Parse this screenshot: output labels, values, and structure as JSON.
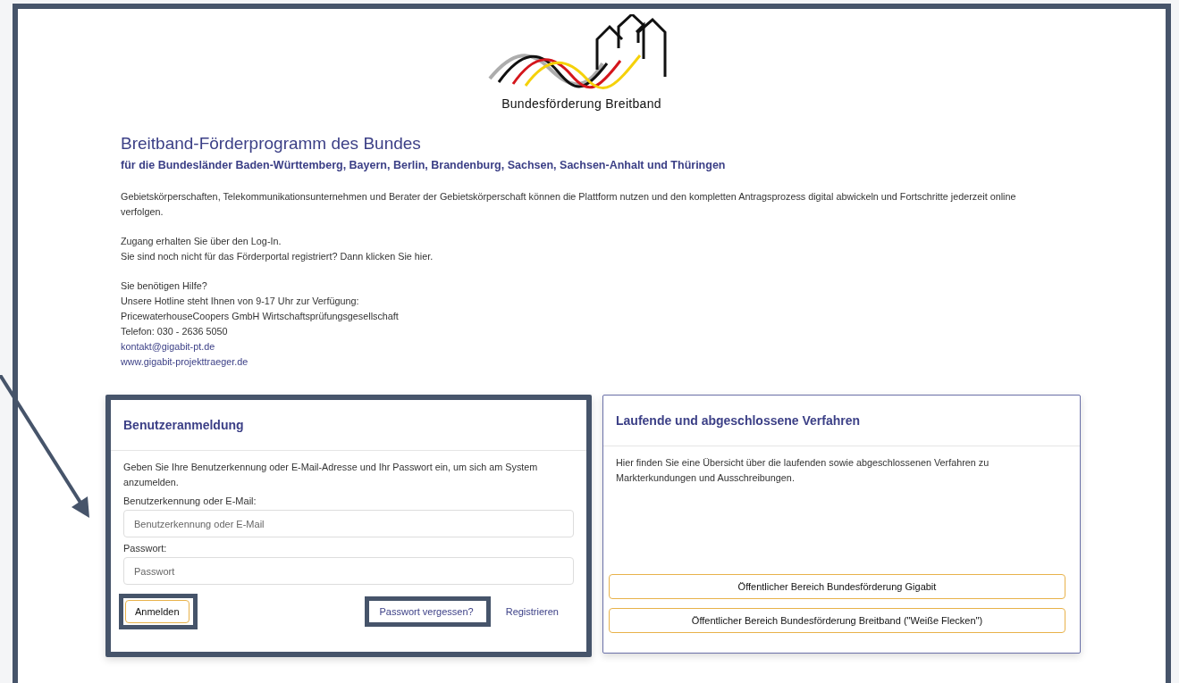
{
  "logo": {
    "text": "Bundesförderung Breitband"
  },
  "heading": {
    "title": "Breitband-Förderprogramm des Bundes",
    "subtitle": "für die Bundesländer Baden-Württemberg, Bayern, Berlin, Brandenburg, Sachsen, Sachsen-Anhalt und Thüringen"
  },
  "paragraphs": [
    {
      "lines": [
        {
          "kind": "text",
          "text": "Gebietskörperschaften, Telekommunikationsunternehmen und Berater der Gebietskörperschaft können die Plattform nutzen und den kompletten Antragsprozess digital abwickeln und Fortschritte jederzeit online verfolgen."
        }
      ]
    },
    {
      "lines": [
        {
          "kind": "text",
          "text": "Zugang erhalten Sie über den Log-In."
        },
        {
          "kind": "text",
          "text": "Sie sind noch nicht für das Förderportal registriert? Dann klicken Sie hier."
        }
      ]
    },
    {
      "lines": [
        {
          "kind": "text",
          "text": "Sie benötigen Hilfe?"
        },
        {
          "kind": "text",
          "text": "Unsere Hotline steht Ihnen von 9-17 Uhr zur Verfügung:"
        },
        {
          "kind": "text",
          "text": "PricewaterhouseCoopers GmbH Wirtschaftsprüfungsgesellschaft"
        },
        {
          "kind": "text",
          "text": "Telefon: 030 - 2636 5050"
        },
        {
          "kind": "link",
          "text": "kontakt@gigabit-pt.de"
        },
        {
          "kind": "link",
          "text": "www.gigabit-projekttraeger.de"
        }
      ]
    }
  ],
  "login_card": {
    "title": "Benutzeranmeldung",
    "highlighted": true,
    "description": "Geben Sie Ihre Benutzerkennung oder E-Mail-Adresse und Ihr Passwort ein, um sich am System anzumelden.",
    "fields": [
      {
        "label": "Benutzerkennung oder E-Mail:",
        "placeholder": "Benutzerkennung oder E-Mail"
      },
      {
        "label": "Passwort:",
        "placeholder": "Passwort"
      }
    ],
    "submit": {
      "label": "Anmelden",
      "highlighted": true
    },
    "links": [
      {
        "label": "Passwort vergessen?",
        "highlighted": true
      },
      {
        "label": "Registrieren",
        "highlighted": false
      }
    ]
  },
  "procedures_card": {
    "title": "Laufende und abgeschlossene Verfahren",
    "description": "Hier finden Sie eine Übersicht über die laufenden sowie abgeschlossenen Verfahren zu Markterkundungen und Ausschreibungen.",
    "buttons": [
      {
        "label": "Öffentlicher Bereich Bundesförderung Gigabit"
      },
      {
        "label": "Öffentlicher Bereich Bundesförderung Breitband (\"Weiße Flecken\")"
      }
    ]
  }
}
